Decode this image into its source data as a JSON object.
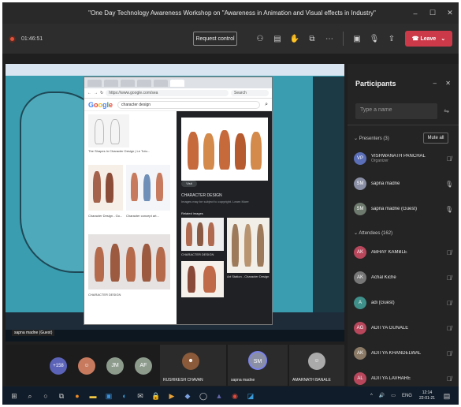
{
  "window": {
    "title": "\"One Day Technology Awareness Workshop on \"Awareness in Animation and Visual effects in Industry\"",
    "minimize": "–",
    "maximize": "☐",
    "close": "✕"
  },
  "toolbar": {
    "timer": "01:46:51",
    "request_control": "Request control",
    "leave": "Leave",
    "leave_caret": "⌄"
  },
  "shared_screen": {
    "presenter_label": "sapna madne (Guest)",
    "browser_url": "https://www.google.com/sea",
    "browser_search_placeholder": "Search",
    "search_query": "character design",
    "google_logo": [
      "G",
      "o",
      "o",
      "g",
      "l",
      "e"
    ],
    "left_captions": [
      "The Shapes In Character Design | Le Tutu...",
      "Character Design - Go...",
      "Character concept art...",
      "CHARACTER DESIGN"
    ],
    "detail_title": "CHARACTER DESIGN",
    "detail_subtitle": "Images may be subject to copyright. Learn More",
    "visit_label": "Visit",
    "related_label": "Related images",
    "related_captions": [
      "CHARACTER DESIGN",
      "Art Station - Character Design"
    ]
  },
  "participants": {
    "title": "Participants",
    "search_placeholder": "Type a name",
    "presenters_label": "Presenters (3)",
    "mute_all": "Mute all",
    "attendees_label": "Attendees (162)",
    "presenters": [
      {
        "initials": "VP",
        "name": "VISHWANATH PANCHAL",
        "role": "Organizer",
        "color": "#5b6fb8"
      },
      {
        "initials": "SM",
        "name": "sapna madne",
        "role": "",
        "color": "#8a8fa5"
      },
      {
        "initials": "SM",
        "name": "sapna madne (Guest)",
        "role": "",
        "color": "#6e7a6e"
      }
    ],
    "attendees": [
      {
        "initials": "AK",
        "name": "ABHAY KAMBLE",
        "color": "#b8475c"
      },
      {
        "initials": "AK",
        "name": "Achal Kiche",
        "color": "#777777"
      },
      {
        "initials": "A",
        "name": "adi (Guest)",
        "color": "#3f8f8a"
      },
      {
        "initials": "AG",
        "name": "ADITYA GUNALE",
        "color": "#b8475c"
      },
      {
        "initials": "AK",
        "name": "ADITYA KHANDELWAL",
        "color": "#8a7a66"
      },
      {
        "initials": "AL",
        "name": "ADITYA LAVHARE",
        "color": "#b8475c"
      }
    ]
  },
  "gallery": {
    "overflow_count": "+158",
    "avatars": [
      {
        "initials": "JM",
        "color": "#8d9b8d"
      },
      {
        "initials": "AF",
        "color": "#8d9b8d"
      }
    ],
    "tiles": [
      {
        "name": "RUSHIKESH CHAVAN"
      },
      {
        "name": "sapna madne",
        "initials": "SM"
      },
      {
        "name": "AMARNATH BANALE"
      }
    ]
  },
  "taskbar": {
    "tray_lang": "ENG",
    "time": "12:14",
    "date": "22-01-21"
  },
  "colors": {
    "leave": "#cc3a4a",
    "panel_bg": "#242424",
    "stage_teal": "#2d8fa3",
    "taskbar": "#101c2a"
  }
}
